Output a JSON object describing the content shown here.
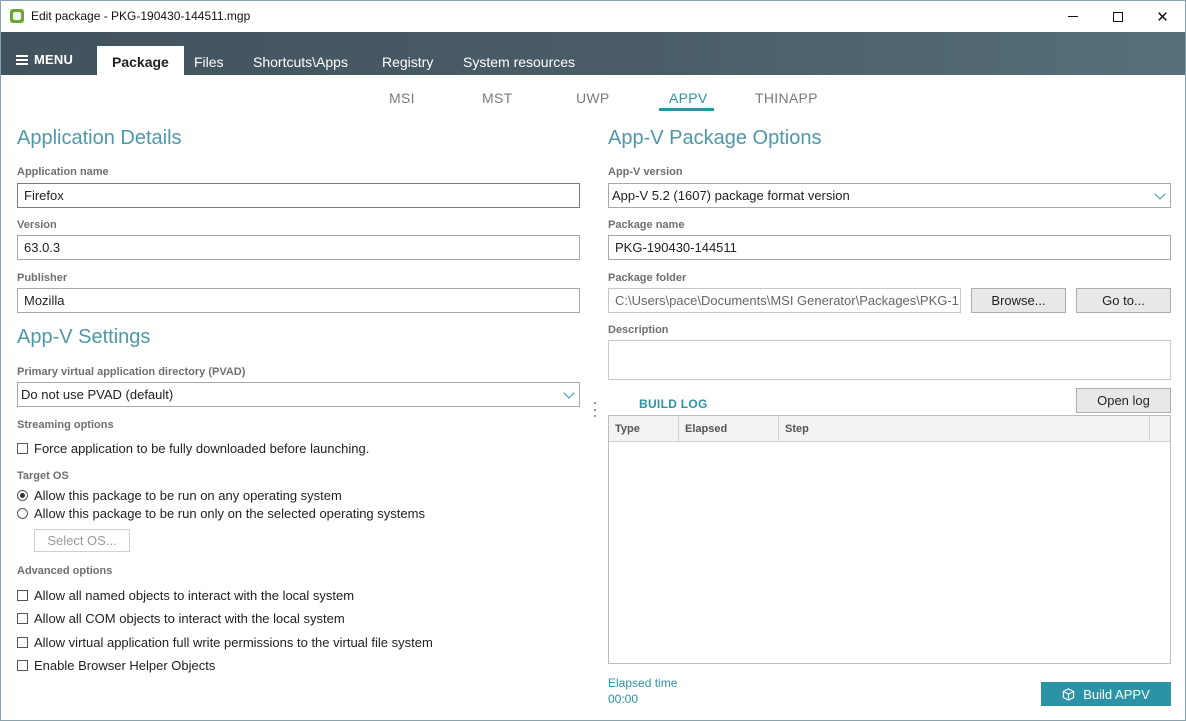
{
  "window": {
    "title": "Edit package - PKG-190430-144511.mgp",
    "controls": {
      "minimize": "minimize",
      "maximize": "maximize",
      "close": "✕"
    }
  },
  "menubar": {
    "menu_label": "MENU",
    "tabs": [
      {
        "label": "Package",
        "active": true
      },
      {
        "label": "Files",
        "active": false
      },
      {
        "label": "Shortcuts\\Apps",
        "active": false
      },
      {
        "label": "Registry",
        "active": false
      },
      {
        "label": "System resources",
        "active": false
      }
    ]
  },
  "subtabs": [
    {
      "label": "MSI",
      "active": false
    },
    {
      "label": "MST",
      "active": false
    },
    {
      "label": "UWP",
      "active": false
    },
    {
      "label": "APPV",
      "active": true
    },
    {
      "label": "THINAPP",
      "active": false
    }
  ],
  "app_details": {
    "heading": "Application Details",
    "name_label": "Application name",
    "name_value": "Firefox",
    "version_label": "Version",
    "version_value": "63.0.3",
    "publisher_label": "Publisher",
    "publisher_value": "Mozilla"
  },
  "appv_settings": {
    "heading": "App-V Settings",
    "pvad_label": "Primary virtual application directory (PVAD)",
    "pvad_value": "Do not use PVAD (default)",
    "streaming_label": "Streaming options",
    "streaming_option": "Force application to be fully downloaded before launching.",
    "streaming_checked": false,
    "target_os_label": "Target OS",
    "os_any": "Allow this package to be run on any operating system",
    "os_selected": "Allow this package to be run only on the selected operating systems",
    "os_choice": "any",
    "select_os_button": "Select OS...",
    "advanced_label": "Advanced options",
    "advanced": [
      {
        "label": "Allow all named objects to interact with the local system",
        "checked": false
      },
      {
        "label": "Allow all COM objects to interact with the local system",
        "checked": false
      },
      {
        "label": "Allow virtual application full write permissions to the virtual file system",
        "checked": false
      },
      {
        "label": "Enable Browser Helper Objects",
        "checked": false
      }
    ]
  },
  "package_options": {
    "heading": "App-V Package Options",
    "version_label": "App-V version",
    "version_value": "App-V 5.2 (1607) package format version",
    "package_name_label": "Package name",
    "package_name_value": "PKG-190430-144511",
    "package_folder_label": "Package folder",
    "package_folder_value": "C:\\Users\\pace\\Documents\\MSI Generator\\Packages\\PKG-1",
    "browse_button": "Browse...",
    "goto_button": "Go to...",
    "description_label": "Description",
    "description_value": ""
  },
  "build_log": {
    "title": "BUILD LOG",
    "open_log_button": "Open log",
    "columns": [
      "Type",
      "Elapsed",
      "Step"
    ],
    "rows": []
  },
  "footer": {
    "elapsed_label": "Elapsed time",
    "elapsed_value": "00:00",
    "build_button": "Build APPV"
  },
  "colors": {
    "accent": "#2c93a6",
    "heading": "#4e98a8",
    "menubar": "#4a5d67",
    "app_icon": "#6aa832"
  },
  "icons": {
    "app": "app-logo-icon",
    "menu": "hamburger-icon",
    "dropdown": "chevron-down-icon",
    "build": "package-box-icon"
  }
}
